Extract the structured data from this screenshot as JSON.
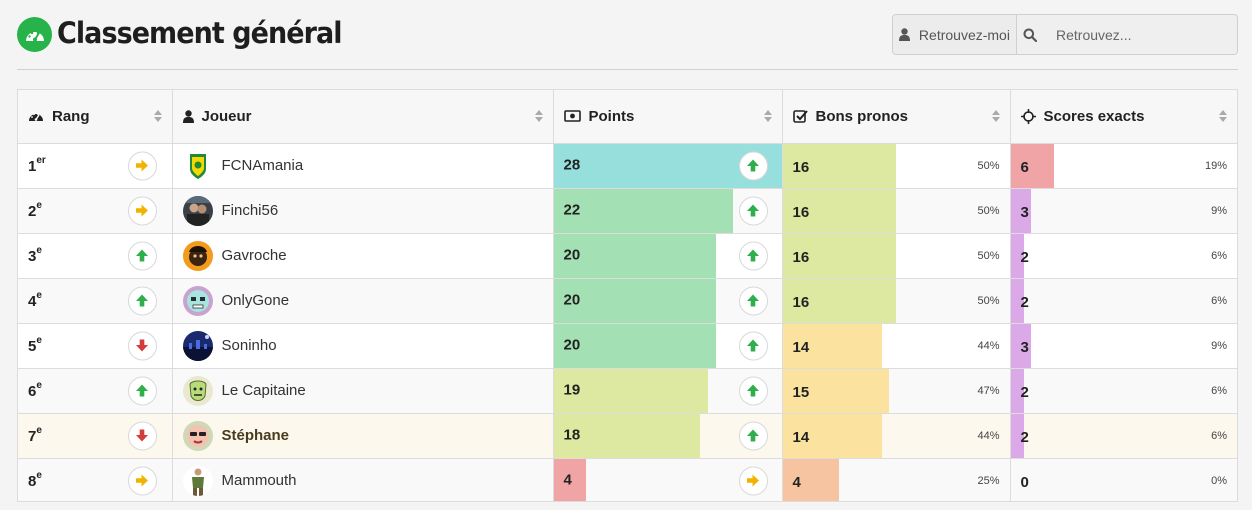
{
  "header": {
    "title": "Classement général",
    "find_me_label": "Retrouvez-moi",
    "search_placeholder": "Retrouvez..."
  },
  "columns": {
    "rank": "Rang",
    "player": "Joueur",
    "points": "Points",
    "good": "Bons pronos",
    "exact": "Scores exacts"
  },
  "colors": {
    "brand_green": "#27b24a",
    "trend_up": "#2fae4c",
    "trend_down": "#d43b3b",
    "trend_same": "#f0b400",
    "bar_teal": "#97dfdc",
    "bar_green": "#a3e0b3",
    "bar_lime": "#dde8a0",
    "bar_yellow": "#fbe39f",
    "bar_orange": "#f7c4a1",
    "bar_red": "#f0a4a6",
    "bar_purple": "#dca9e8"
  },
  "rows": [
    {
      "rank_num": "1",
      "rank_suffix": "er",
      "rank_trend": "same",
      "player": "FCNAmania",
      "avatar": "canary-badge",
      "points": "28",
      "points_frac": 1.0,
      "points_color": "#97dfdc",
      "points_trend": "up",
      "good": "16",
      "good_pct": "50%",
      "good_frac": 0.5,
      "good_color": "#dde8a0",
      "exact": "6",
      "exact_pct": "19%",
      "exact_frac": 0.19,
      "exact_color": "#f0a4a6"
    },
    {
      "rank_num": "2",
      "rank_suffix": "e",
      "rank_trend": "same",
      "player": "Finchi56",
      "avatar": "photo-pair",
      "points": "22",
      "points_frac": 0.786,
      "points_color": "#a3e0b3",
      "points_trend": "up",
      "good": "16",
      "good_pct": "50%",
      "good_frac": 0.5,
      "good_color": "#dde8a0",
      "exact": "3",
      "exact_pct": "9%",
      "exact_frac": 0.09,
      "exact_color": "#dca9e8"
    },
    {
      "rank_num": "3",
      "rank_suffix": "e",
      "rank_trend": "up",
      "player": "Gavroche",
      "avatar": "orange-face",
      "points": "20",
      "points_frac": 0.714,
      "points_color": "#a3e0b3",
      "points_trend": "up",
      "good": "16",
      "good_pct": "50%",
      "good_frac": 0.5,
      "good_color": "#dde8a0",
      "exact": "2",
      "exact_pct": "6%",
      "exact_frac": 0.06,
      "exact_color": "#dca9e8"
    },
    {
      "rank_num": "4",
      "rank_suffix": "e",
      "rank_trend": "up",
      "player": "OnlyGone",
      "avatar": "skull-face",
      "points": "20",
      "points_frac": 0.714,
      "points_color": "#a3e0b3",
      "points_trend": "up",
      "good": "16",
      "good_pct": "50%",
      "good_frac": 0.5,
      "good_color": "#dde8a0",
      "exact": "2",
      "exact_pct": "6%",
      "exact_frac": 0.06,
      "exact_color": "#dca9e8"
    },
    {
      "rank_num": "5",
      "rank_suffix": "e",
      "rank_trend": "down",
      "player": "Soninho",
      "avatar": "night-city",
      "points": "20",
      "points_frac": 0.714,
      "points_color": "#a3e0b3",
      "points_trend": "up",
      "good": "14",
      "good_pct": "44%",
      "good_frac": 0.44,
      "good_color": "#fbe39f",
      "exact": "3",
      "exact_pct": "9%",
      "exact_frac": 0.09,
      "exact_color": "#dca9e8"
    },
    {
      "rank_num": "6",
      "rank_suffix": "e",
      "rank_trend": "up",
      "player": "Le Capitaine",
      "avatar": "green-face",
      "points": "19",
      "points_frac": 0.679,
      "points_color": "#dde8a0",
      "points_trend": "up",
      "good": "15",
      "good_pct": "47%",
      "good_frac": 0.47,
      "good_color": "#fbe39f",
      "exact": "2",
      "exact_pct": "6%",
      "exact_frac": 0.06,
      "exact_color": "#dca9e8"
    },
    {
      "rank_num": "7",
      "rank_suffix": "e",
      "rank_trend": "down",
      "player": "Stéphane",
      "avatar": "sunglasses-face",
      "points": "18",
      "points_frac": 0.643,
      "points_color": "#dde8a0",
      "points_trend": "up",
      "good": "14",
      "good_pct": "44%",
      "good_frac": 0.44,
      "good_color": "#fbe39f",
      "exact": "2",
      "exact_pct": "6%",
      "exact_frac": 0.06,
      "exact_color": "#dca9e8",
      "is_me": true
    },
    {
      "rank_num": "8",
      "rank_suffix": "e",
      "rank_trend": "same",
      "player": "Mammouth",
      "avatar": "standing-figure",
      "points": "4",
      "points_frac": 0.143,
      "points_color": "#f0a4a6",
      "points_trend": "same",
      "good": "4",
      "good_pct": "25%",
      "good_frac": 0.25,
      "good_color": "#f7c4a1",
      "exact": "0",
      "exact_pct": "0%",
      "exact_frac": 0,
      "exact_color": "#dca9e8"
    }
  ]
}
